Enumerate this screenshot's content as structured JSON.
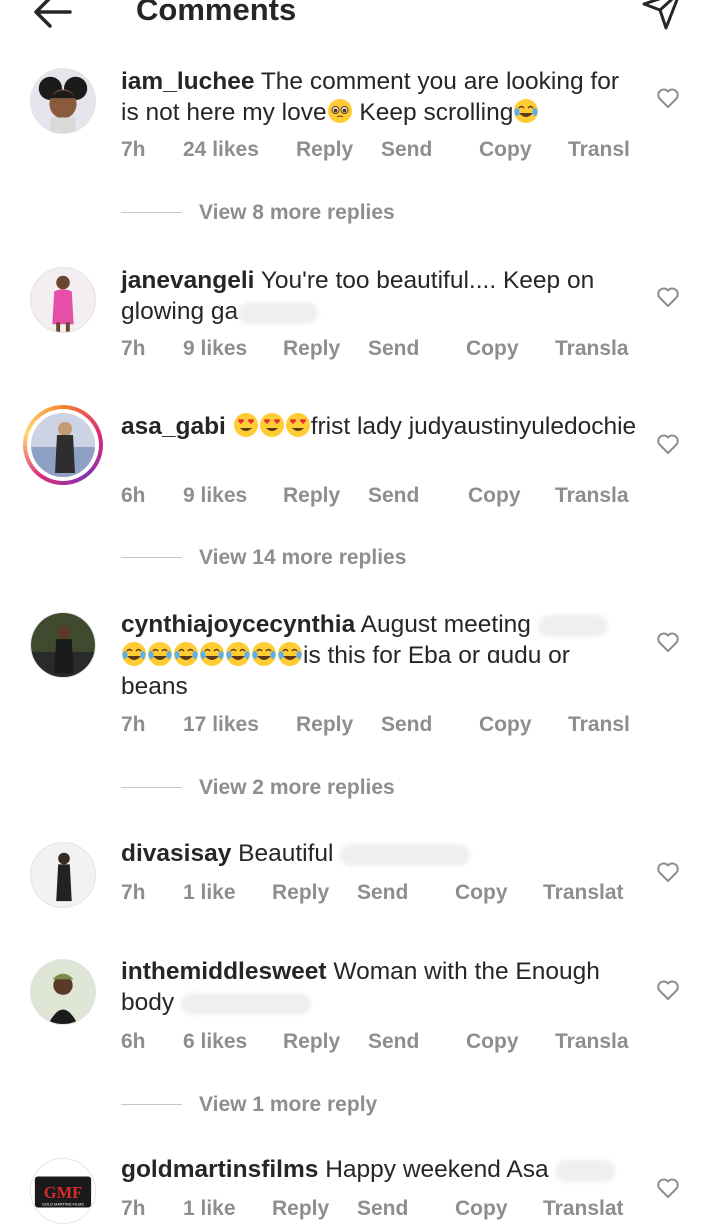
{
  "header": {
    "title": "Comments"
  },
  "comments": [
    {
      "username": "iam_luchee",
      "text_a": "The comment you are looking for is not here my love",
      "text_b": " Keep scrolling",
      "time": "7h",
      "likes": "24 likes",
      "reply": "Reply",
      "send": "Send",
      "copy": "Copy",
      "translate": "Transl",
      "view_replies": "View 8 more replies"
    },
    {
      "username": "janevangeli",
      "text_a": "You're too beautiful.... Keep on glowing ga",
      "time": "7h",
      "likes": "9 likes",
      "reply": "Reply",
      "send": "Send",
      "copy": "Copy",
      "translate": "Transla"
    },
    {
      "username": "asa_gabi",
      "text_a": "frist lady judyaustinyuledochie",
      "time": "6h",
      "likes": "9 likes",
      "reply": "Reply",
      "send": "Send",
      "copy": "Copy",
      "translate": "Transla",
      "view_replies": "View 14 more replies"
    },
    {
      "username": "cynthiajoycecynthia",
      "text_a": "August meeting",
      "text_b": "is this for Eba or ɑudu or beans",
      "time": "7h",
      "likes": "17 likes",
      "reply": "Reply",
      "send": "Send",
      "copy": "Copy",
      "translate": "Transl",
      "view_replies": "View 2 more replies"
    },
    {
      "username": "divasisay",
      "text_a": "Beautiful",
      "time": "7h",
      "likes": "1 like",
      "reply": "Reply",
      "send": "Send",
      "copy": "Copy",
      "translate": "Translat"
    },
    {
      "username": "inthemiddlesweet",
      "text_a": "Woman with the Enough body",
      "time": "6h",
      "likes": "6 likes",
      "reply": "Reply",
      "send": "Send",
      "copy": "Copy",
      "translate": "Transla",
      "view_replies": "View 1 more reply"
    },
    {
      "username": "goldmartinsfilms",
      "text_a": "Happy weekend Asa",
      "time": "7h",
      "likes": "1 like",
      "reply": "Reply",
      "send": "Send",
      "copy": "Copy",
      "translate": "Translat",
      "avatar_logo": "GMF",
      "avatar_logo_sub": "GOLD MARTINS FILMS"
    }
  ],
  "icons": {
    "back": "arrow-left-icon",
    "send": "paper-plane-icon",
    "like": "heart-outline-icon"
  },
  "colors": {
    "text": "#262626",
    "secondary": "#8e8e8e"
  }
}
